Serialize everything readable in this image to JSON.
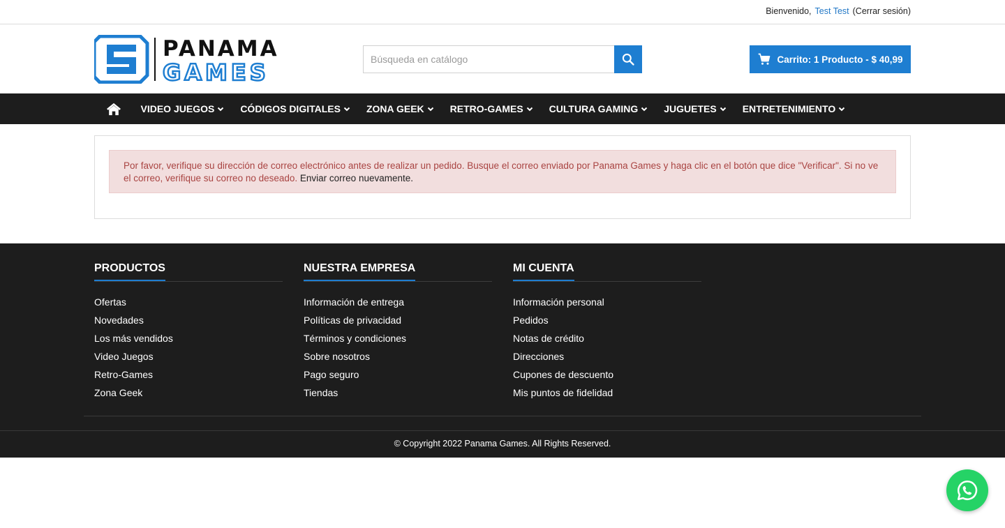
{
  "topbar": {
    "welcome": "Bienvenido,",
    "user_name": "Test Test",
    "logout": "(Cerrar sesión)"
  },
  "header": {
    "logo_text_top": "PANAMA",
    "logo_text_bottom": "GAMES",
    "search_placeholder": "Búsqueda en catálogo",
    "cart_label": "Carrito: 1 Producto - $ 40,99"
  },
  "nav": {
    "items": [
      {
        "label": "VIDEO JUEGOS"
      },
      {
        "label": "CÓDIGOS DIGITALES"
      },
      {
        "label": "ZONA GEEK"
      },
      {
        "label": "RETRO-GAMES"
      },
      {
        "label": "CULTURA GAMING"
      },
      {
        "label": "JUGUETES"
      },
      {
        "label": "ENTRETENIMIENTO"
      }
    ]
  },
  "alert": {
    "message": "Por favor, verifique su dirección de correo electrónico antes de realizar un pedido. Busque el correo enviado por Panama Games y haga clic en el botón que dice \"Verificar\". Si no ve el correo, verifique su correo no deseado. ",
    "link": "Enviar correo nuevamente."
  },
  "footer": {
    "columns": [
      {
        "heading": "PRODUCTOS",
        "links": [
          "Ofertas",
          "Novedades",
          "Los más vendidos",
          "Video Juegos",
          "Retro-Games",
          "Zona Geek"
        ]
      },
      {
        "heading": "NUESTRA EMPRESA",
        "links": [
          "Información de entrega",
          "Políticas de privacidad",
          "Términos y condiciones",
          "Sobre nosotros",
          "Pago seguro",
          "Tiendas"
        ]
      },
      {
        "heading": "MI CUENTA",
        "links": [
          "Información personal",
          "Pedidos",
          "Notas de crédito",
          "Direcciones",
          "Cupones de descuento",
          "Mis puntos de fidelidad"
        ]
      }
    ],
    "copyright": "© Copyright 2022 Panama Games. All Rights Reserved."
  },
  "colors": {
    "accent": "#1e7ed1",
    "nav_bg": "#1d1d1d",
    "alert_bg": "#f2dede",
    "alert_text": "#a94442",
    "whatsapp": "#25d366"
  },
  "icons": {
    "home": "home-icon",
    "search": "search-icon",
    "cart": "cart-icon",
    "chevron": "chevron-down-icon",
    "whatsapp": "whatsapp-icon"
  }
}
